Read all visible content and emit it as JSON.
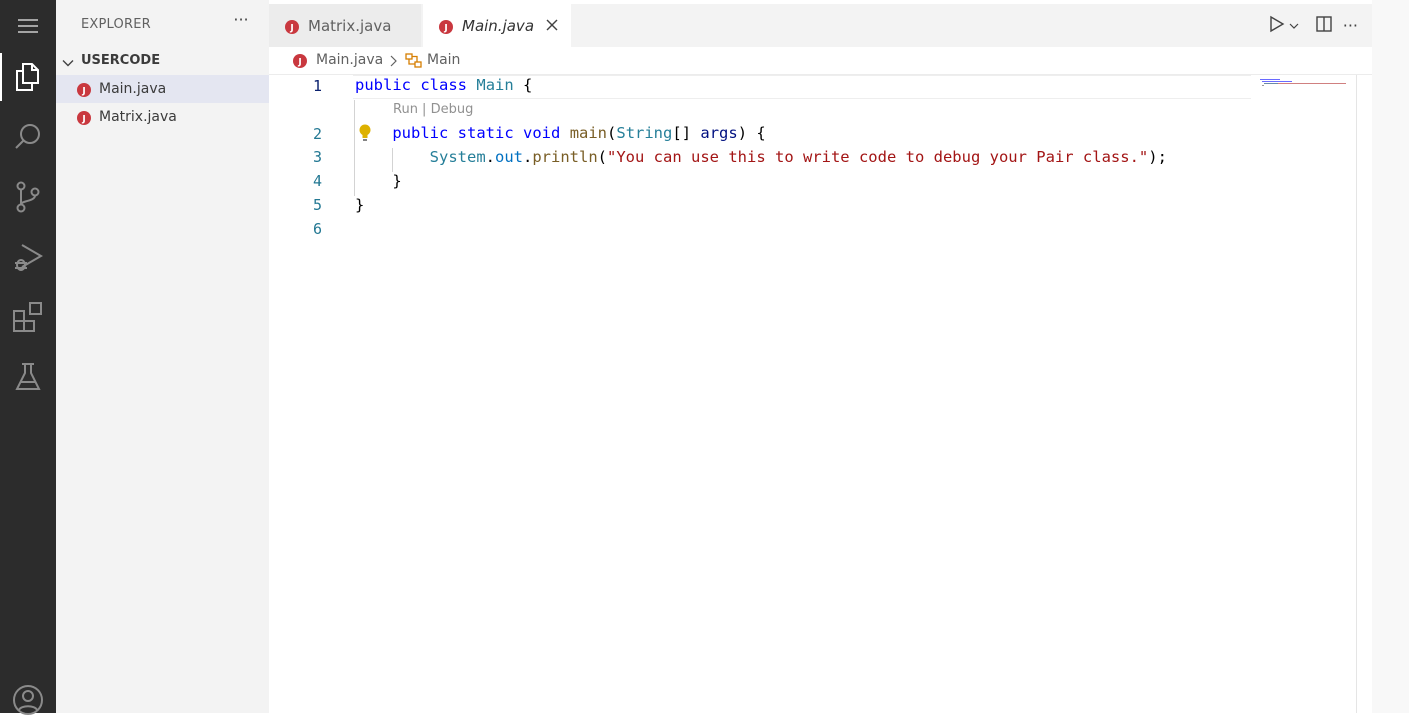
{
  "activity_bar": {
    "items": [
      {
        "icon": "menu-icon"
      },
      {
        "icon": "explorer-icon",
        "active": true
      },
      {
        "icon": "search-icon"
      },
      {
        "icon": "source-control-icon"
      },
      {
        "icon": "run-debug-icon"
      },
      {
        "icon": "extensions-icon"
      },
      {
        "icon": "testing-icon"
      }
    ],
    "bottom": {
      "icon": "account-icon"
    }
  },
  "sidebar": {
    "title": "EXPLORER",
    "more": "···",
    "folder": "USERCODE",
    "files": [
      {
        "name": "Main.java",
        "selected": true
      },
      {
        "name": "Matrix.java",
        "selected": false
      }
    ]
  },
  "tabs": [
    {
      "label": "Matrix.java",
      "active": false
    },
    {
      "label": "Main.java",
      "active": true
    }
  ],
  "toolbar": {
    "more": "···"
  },
  "breadcrumb": {
    "file": "Main.java",
    "symbol": "Main"
  },
  "editor": {
    "codelens": "Run | Debug",
    "line_numbers": [
      "1",
      "2",
      "3",
      "4",
      "5",
      "6"
    ],
    "lines": {
      "l1": {
        "kw1": "public",
        "kw2": "class",
        "cls": "Main",
        "rest": " {"
      },
      "l2": {
        "kw1": "public",
        "kw2": "static",
        "kw3": "void",
        "fn": "main",
        "p1": "(",
        "ty": "String",
        "p2": "[] ",
        "var": "args",
        "p3": ") {"
      },
      "l3": {
        "ty": "System",
        "dot1": ".",
        "prop": "out",
        "dot2": ".",
        "fn": "println",
        "p1": "(",
        "str": "\"You can use this to write code to debug your Pair class.\"",
        "p2": ");"
      },
      "l4": {
        "text": "}"
      },
      "l5": {
        "text": "}"
      }
    }
  },
  "colors": {
    "activity_bg": "#2c2c2c",
    "sidebar_bg": "#f3f3f3",
    "java_icon": "#c9383f",
    "keyword": "#0000ff",
    "type": "#267f99",
    "string": "#a31515"
  }
}
